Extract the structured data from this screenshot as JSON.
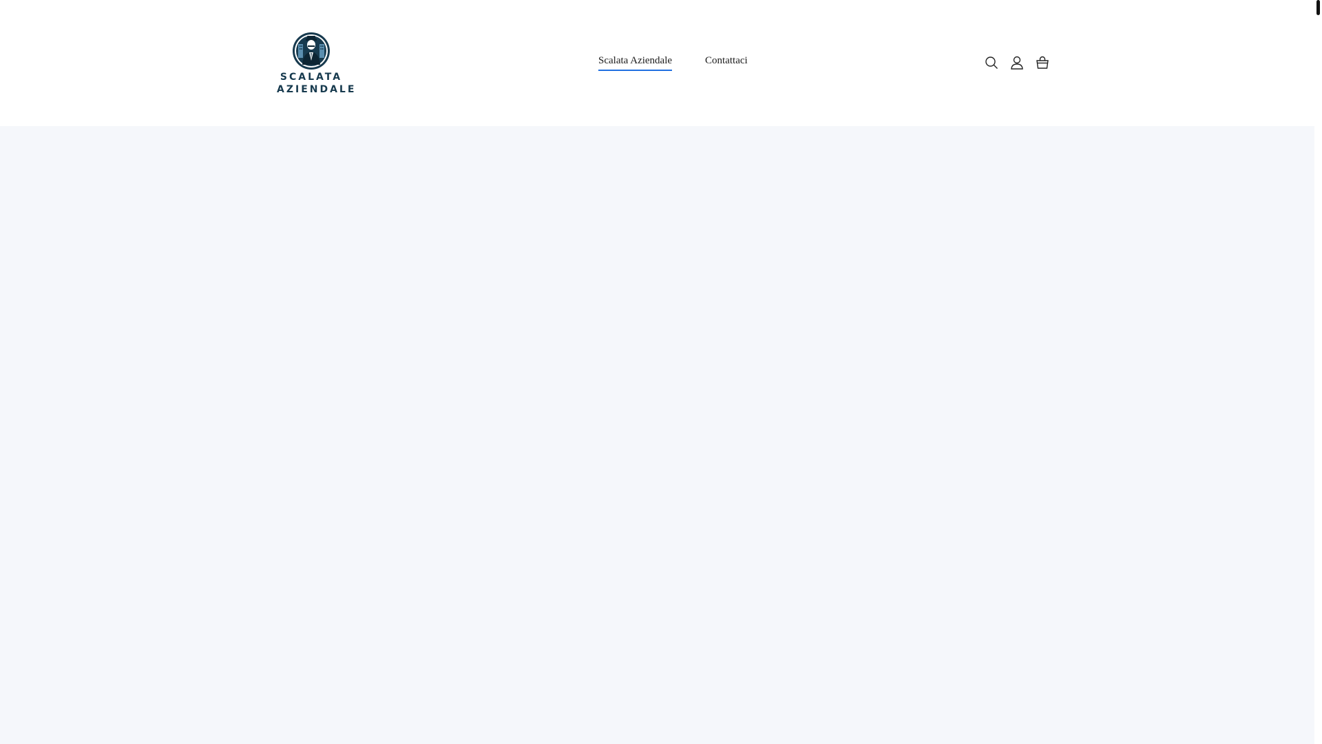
{
  "header": {
    "logo": {
      "line1": "SCALATA",
      "line2": "AZIENDALE"
    },
    "nav": [
      {
        "label": "Scalata Aziendale",
        "active": true
      },
      {
        "label": "Contattaci",
        "active": false
      }
    ],
    "icons": [
      "search-icon",
      "account-icon",
      "cart-icon"
    ]
  },
  "colors": {
    "nav_underline": "#1f6fe0",
    "logo_text": "#173a4e",
    "main_background": "#f5f7fb"
  }
}
